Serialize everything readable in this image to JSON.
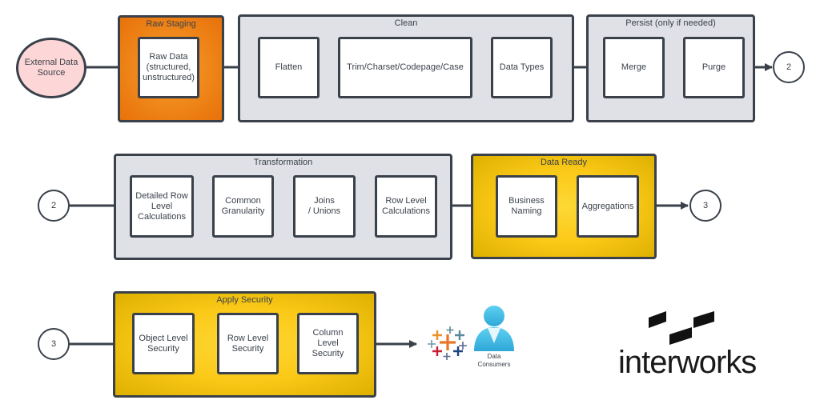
{
  "source": {
    "label": "External Data\nSource",
    "color": "#fdd7d7"
  },
  "groups": {
    "raw_staging": {
      "title": "Raw Staging",
      "steps": [
        "Raw Data\n(structured,\nunstructured)"
      ]
    },
    "clean": {
      "title": "Clean",
      "steps": [
        "Flatten",
        "Trim/Charset/Codepage/Case",
        "Data Types"
      ]
    },
    "persist": {
      "title": "Persist (only if needed)",
      "steps": [
        "Merge",
        "Purge"
      ]
    },
    "transformation": {
      "title": "Transformation",
      "steps": [
        "Detailed Row\nLevel\nCalculations",
        "Common\nGranularity",
        "Joins\n/ Unions",
        "Row Level\nCalculations"
      ]
    },
    "data_ready": {
      "title": "Data Ready",
      "steps": [
        "Business\nNaming",
        "Aggregations"
      ]
    },
    "apply_security": {
      "title": "Apply Security",
      "steps": [
        "Object Level\nSecurity",
        "Row Level\nSecurity",
        "Column Level\nSecurity"
      ]
    }
  },
  "connectors": {
    "to_2": "2",
    "from_2": "2",
    "to_3": "3",
    "from_3": "3"
  },
  "consumers": {
    "label": "Data\nConsumers"
  },
  "logo": {
    "text": "interworks"
  },
  "colors": {
    "line": "#3a414a",
    "gray_group": "#dfe1e6",
    "orange_group": "#f08a1c",
    "yellow_group": "#fbc918"
  }
}
